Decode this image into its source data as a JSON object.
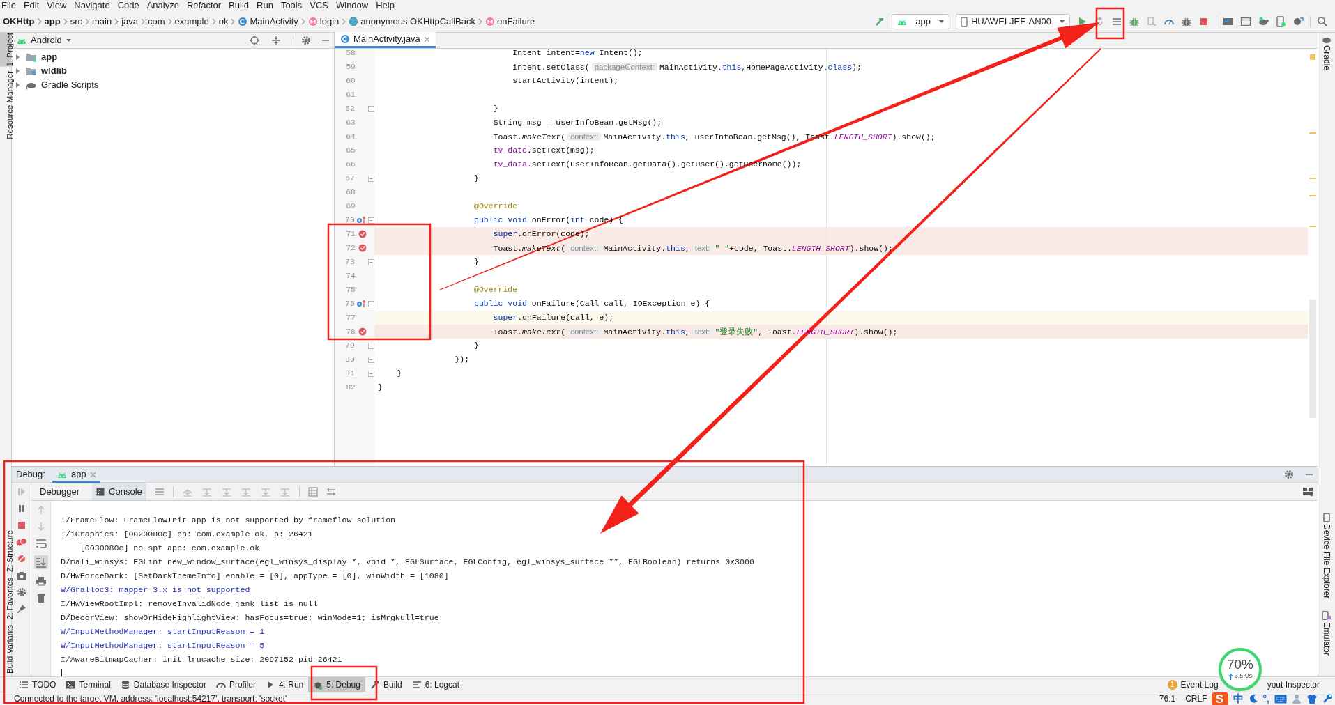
{
  "menu": [
    "File",
    "Edit",
    "View",
    "Navigate",
    "Code",
    "Analyze",
    "Refactor",
    "Build",
    "Run",
    "Tools",
    "VCS",
    "Window",
    "Help"
  ],
  "breadcrumbs": [
    {
      "label": "OKHttp",
      "kind": "project"
    },
    {
      "label": "app",
      "kind": "module"
    },
    {
      "label": "src",
      "kind": "folder"
    },
    {
      "label": "main",
      "kind": "folder"
    },
    {
      "label": "java",
      "kind": "folder"
    },
    {
      "label": "com",
      "kind": "folder"
    },
    {
      "label": "example",
      "kind": "folder"
    },
    {
      "label": "ok",
      "kind": "folder"
    },
    {
      "label": "MainActivity",
      "kind": "class"
    },
    {
      "label": "login",
      "kind": "method"
    },
    {
      "label": "anonymous OKHttpCallBack",
      "kind": "anonymous"
    },
    {
      "label": "onFailure",
      "kind": "method"
    }
  ],
  "run_config": "app",
  "device": "HUAWEI JEF-AN00",
  "left_stripe_top": [
    {
      "label": "1: Project",
      "selected": true
    },
    {
      "label": "Resource Manager",
      "selected": false
    }
  ],
  "left_stripe_bottom": [
    {
      "label": "Z: Structure",
      "selected": false
    },
    {
      "label": "2: Favorites",
      "selected": false
    },
    {
      "label": "Build Variants",
      "selected": false
    }
  ],
  "right_stripe_top": [
    {
      "label": "Gradle",
      "kind": "gradle"
    }
  ],
  "right_stripe_bottom": [
    {
      "label": "Device File Explorer",
      "kind": "device"
    },
    {
      "label": "Emulator",
      "kind": "emulator"
    }
  ],
  "project_panel": {
    "view": "Android",
    "tree": [
      {
        "label": "app",
        "kind": "module",
        "expanded": false
      },
      {
        "label": "wldlib",
        "kind": "library",
        "expanded": false
      },
      {
        "label": "Gradle Scripts",
        "kind": "gradle",
        "expanded": false
      }
    ]
  },
  "editor": {
    "tabs": [
      {
        "label": "MainActivity.java",
        "selected": true
      }
    ],
    "lines": [
      {
        "n": "58",
        "breakpoint": false,
        "override": false,
        "current": false,
        "fold": false,
        "code": [
          {
            "text": "                            Intent intent=",
            "kind": "plain"
          },
          {
            "text": "new",
            "kind": "keyword"
          },
          {
            "text": " Intent();",
            "kind": "plain"
          }
        ]
      },
      {
        "n": "59",
        "breakpoint": false,
        "override": false,
        "current": false,
        "fold": false,
        "code": [
          {
            "text": "                            intent.setClass(",
            "kind": "plain"
          },
          {
            "text": "packageContext:",
            "kind": "hint"
          },
          {
            "text": "MainActivity.",
            "kind": "plain"
          },
          {
            "text": "this",
            "kind": "keyword"
          },
          {
            "text": ",HomePageActivity.",
            "kind": "plain"
          },
          {
            "text": "class",
            "kind": "keyword"
          },
          {
            "text": ");",
            "kind": "plain"
          }
        ]
      },
      {
        "n": "60",
        "breakpoint": false,
        "override": false,
        "current": false,
        "fold": false,
        "code": [
          {
            "text": "                            startActivity(intent);",
            "kind": "plain"
          }
        ]
      },
      {
        "n": "61",
        "breakpoint": false,
        "override": false,
        "current": false,
        "fold": false
      },
      {
        "n": "62",
        "breakpoint": false,
        "override": false,
        "current": false,
        "fold": true,
        "code": [
          {
            "text": "                        }",
            "kind": "plain"
          }
        ]
      },
      {
        "n": "63",
        "breakpoint": false,
        "override": false,
        "current": false,
        "fold": false,
        "code": [
          {
            "text": "                        String msg = userInfoBean.getMsg();",
            "kind": "plain"
          }
        ]
      },
      {
        "n": "64",
        "breakpoint": false,
        "override": false,
        "current": false,
        "fold": false,
        "code": [
          {
            "text": "                        Toast.",
            "kind": "plain"
          },
          {
            "text": "makeText",
            "kind": "italic"
          },
          {
            "text": "(",
            "kind": "plain"
          },
          {
            "text": "context:",
            "kind": "hint"
          },
          {
            "text": "MainActivity.",
            "kind": "plain"
          },
          {
            "text": "this",
            "kind": "keyword"
          },
          {
            "text": ", userInfoBean.getMsg(), Toast.",
            "kind": "plain"
          },
          {
            "text": "LENGTH_SHORT",
            "kind": "constant"
          },
          {
            "text": ").show();",
            "kind": "plain"
          }
        ]
      },
      {
        "n": "65",
        "breakpoint": false,
        "override": false,
        "current": false,
        "fold": false,
        "code": [
          {
            "text": "                        tv_date",
            "kind": "field"
          },
          {
            "text": ".setText(msg);",
            "kind": "plain"
          }
        ]
      },
      {
        "n": "66",
        "breakpoint": false,
        "override": false,
        "current": false,
        "fold": false,
        "code": [
          {
            "text": "                        tv_data",
            "kind": "field"
          },
          {
            "text": ".setText(userInfoBean.getData().getUser().getUsername());",
            "kind": "plain"
          }
        ]
      },
      {
        "n": "67",
        "breakpoint": false,
        "override": false,
        "current": false,
        "fold": true,
        "code": [
          {
            "text": "                    }",
            "kind": "plain"
          }
        ]
      },
      {
        "n": "68",
        "breakpoint": false,
        "override": false,
        "current": false,
        "fold": false
      },
      {
        "n": "69",
        "breakpoint": false,
        "override": false,
        "current": false,
        "fold": false,
        "code": [
          {
            "text": "                    @Override",
            "kind": "annotation"
          }
        ]
      },
      {
        "n": "70",
        "breakpoint": false,
        "override": true,
        "current": false,
        "fold": true,
        "code": [
          {
            "text": "                    public void",
            "kind": "keyword"
          },
          {
            "text": " onError(",
            "kind": "plain"
          },
          {
            "text": "int",
            "kind": "keyword"
          },
          {
            "text": " code) {",
            "kind": "plain"
          }
        ]
      },
      {
        "n": "71",
        "breakpoint": true,
        "override": false,
        "current": false,
        "fold": false,
        "code": [
          {
            "text": "                        super",
            "kind": "keyword"
          },
          {
            "text": ".onError(code);",
            "kind": "plain"
          }
        ]
      },
      {
        "n": "72",
        "breakpoint": true,
        "override": false,
        "current": false,
        "fold": false,
        "code": [
          {
            "text": "                        Toast.",
            "kind": "plain"
          },
          {
            "text": "makeText",
            "kind": "italic"
          },
          {
            "text": "(",
            "kind": "plain"
          },
          {
            "text": "context:",
            "kind": "hint"
          },
          {
            "text": "MainActivity.",
            "kind": "plain"
          },
          {
            "text": "this",
            "kind": "keyword"
          },
          {
            "text": ",",
            "kind": "plain"
          },
          {
            "text": "text:",
            "kind": "hint"
          },
          {
            "text": "\" \"",
            "kind": "string"
          },
          {
            "text": "+code, Toast.",
            "kind": "plain"
          },
          {
            "text": "LENGTH_SHORT",
            "kind": "constant"
          },
          {
            "text": ").show();",
            "kind": "plain"
          }
        ]
      },
      {
        "n": "73",
        "breakpoint": false,
        "override": false,
        "current": false,
        "fold": true,
        "code": [
          {
            "text": "                    }",
            "kind": "plain"
          }
        ]
      },
      {
        "n": "74",
        "breakpoint": false,
        "override": false,
        "current": false,
        "fold": false
      },
      {
        "n": "75",
        "breakpoint": false,
        "override": false,
        "current": false,
        "fold": false,
        "code": [
          {
            "text": "                    @Override",
            "kind": "annotation"
          }
        ]
      },
      {
        "n": "76",
        "breakpoint": false,
        "override": true,
        "current": false,
        "fold": true,
        "code": [
          {
            "text": "                    public void",
            "kind": "keyword"
          },
          {
            "text": " onFailure(Call call, IOException e) {",
            "kind": "plain"
          }
        ]
      },
      {
        "n": "77",
        "breakpoint": false,
        "override": false,
        "current": true,
        "fold": false,
        "code": [
          {
            "text": "                        super",
            "kind": "keyword"
          },
          {
            "text": ".onFailure(call, e);",
            "kind": "plain"
          }
        ]
      },
      {
        "n": "78",
        "breakpoint": true,
        "override": false,
        "current": false,
        "fold": false,
        "code": [
          {
            "text": "                        Toast.",
            "kind": "plain"
          },
          {
            "text": "makeText",
            "kind": "italic"
          },
          {
            "text": "(",
            "kind": "plain"
          },
          {
            "text": "context:",
            "kind": "hint"
          },
          {
            "text": "MainActivity.",
            "kind": "plain"
          },
          {
            "text": "this",
            "kind": "keyword"
          },
          {
            "text": ",",
            "kind": "plain"
          },
          {
            "text": "text:",
            "kind": "hint"
          },
          {
            "text": "\"登录失败\"",
            "kind": "string"
          },
          {
            "text": ", Toast.",
            "kind": "plain"
          },
          {
            "text": "LENGTH_SHORT",
            "kind": "constant"
          },
          {
            "text": ").show();",
            "kind": "plain"
          }
        ]
      },
      {
        "n": "79",
        "breakpoint": false,
        "override": false,
        "current": false,
        "fold": true,
        "code": [
          {
            "text": "                    }",
            "kind": "plain"
          }
        ]
      },
      {
        "n": "80",
        "breakpoint": false,
        "override": false,
        "current": false,
        "fold": true,
        "code": [
          {
            "text": "                });",
            "kind": "plain"
          }
        ]
      },
      {
        "n": "81",
        "breakpoint": false,
        "override": false,
        "current": false,
        "fold": true,
        "code": [
          {
            "text": "    }",
            "kind": "plain"
          }
        ]
      },
      {
        "n": "82",
        "breakpoint": false,
        "override": false,
        "current": false,
        "fold": false,
        "code": [
          {
            "text": "}",
            "kind": "plain"
          }
        ]
      }
    ]
  },
  "debug": {
    "title": "Debug:",
    "tabs": [
      {
        "label": "app",
        "selected": true
      }
    ],
    "subtabs": [
      {
        "label": "Debugger",
        "selected": false
      },
      {
        "label": "Console",
        "selected": true
      }
    ],
    "console": [
      {
        "text": "I/FrameFlow: FrameFlowInit app is not supported by frameflow solution",
        "kind": "plain"
      },
      {
        "text": "I/iGraphics: [0020080c] pn: com.example.ok, p: 26421",
        "kind": "plain"
      },
      {
        "text": "    [0030080c] no spt app: com.example.ok",
        "kind": "plain"
      },
      {
        "text": "D/mali_winsys: EGLint new_window_surface(egl_winsys_display *, void *, EGLSurface, EGLConfig, egl_winsys_surface **, EGLBoolean) returns 0x3000",
        "kind": "plain"
      },
      {
        "text": "D/HwForceDark: [SetDarkThemeInfo] enable = [0], appType = [0], winWidth = [1080]",
        "kind": "plain"
      },
      {
        "text": "W/Gralloc3: mapper 3.x is not supported",
        "kind": "warning"
      },
      {
        "text": "I/HwViewRootImpl: removeInvalidNode jank list is null",
        "kind": "plain"
      },
      {
        "text": "D/DecorView: showOrHideHighlightView: hasFocus=true; winMode=1; isMrgNull=true",
        "kind": "plain"
      },
      {
        "text": "W/InputMethodManager: startInputReason = 1",
        "kind": "warning"
      },
      {
        "text": "W/InputMethodManager: startInputReason = 5",
        "kind": "warning"
      },
      {
        "text": "I/AwareBitmapCacher: init lrucache size: 2097152 pid=26421",
        "kind": "plain"
      }
    ]
  },
  "tool_tabs": [
    {
      "label": "TODO",
      "kind": "todo",
      "selected": false
    },
    {
      "label": "Terminal",
      "kind": "terminal",
      "selected": false
    },
    {
      "label": "Database Inspector",
      "kind": "database",
      "selected": false
    },
    {
      "label": "Profiler",
      "kind": "profiler",
      "selected": false
    },
    {
      "label": "4: Run",
      "kind": "run",
      "selected": false
    },
    {
      "label": "5: Debug",
      "kind": "debug",
      "selected": true
    },
    {
      "label": "Build",
      "kind": "build",
      "selected": false
    },
    {
      "label": "6: Logcat",
      "kind": "logcat",
      "selected": false
    }
  ],
  "tool_tabs_right": [
    {
      "label": "Event Log",
      "badge": "1"
    },
    {
      "label": "yout Inspector"
    }
  ],
  "status": {
    "message": "Connected to the target VM, address: 'localhost:54217', transport: 'socket'",
    "position": "76:1",
    "line_separator": "CRLF"
  },
  "network_widget": {
    "percent": "70%",
    "rate": "3.5K/s"
  },
  "ime_toolbar": {
    "logo": "S",
    "mode": "中",
    "punctuation": "°,"
  }
}
